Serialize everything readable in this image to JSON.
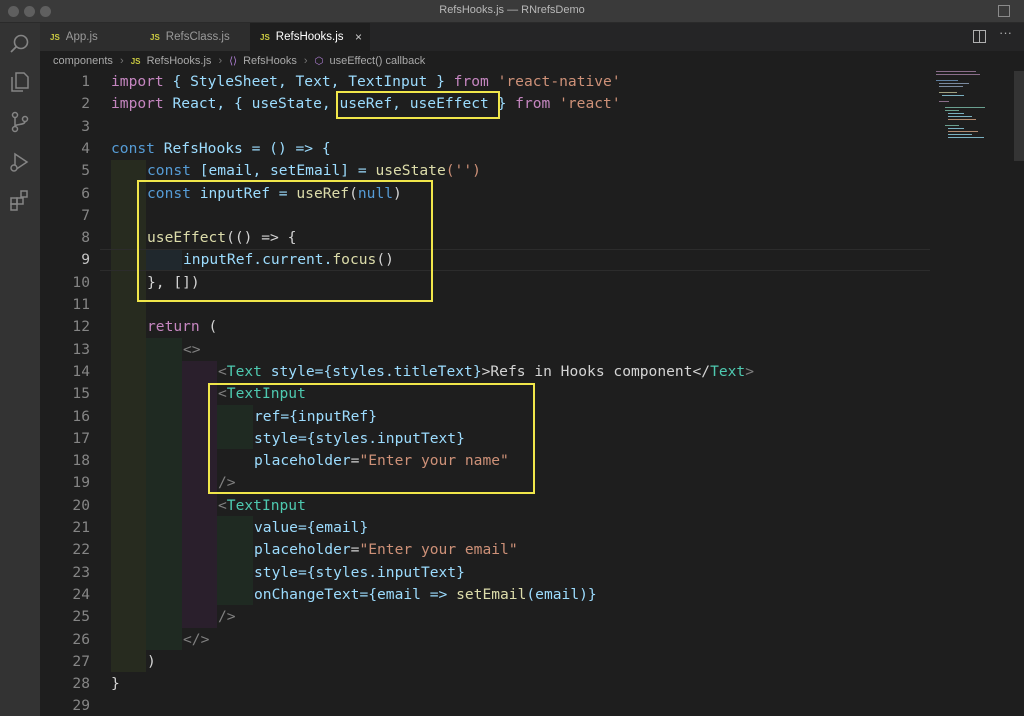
{
  "window": {
    "title": "RefsHooks.js — RNrefsDemo"
  },
  "tabs": [
    {
      "label": "App.js",
      "badge": "JS",
      "active": false
    },
    {
      "label": "RefsClass.js",
      "badge": "JS",
      "active": false
    },
    {
      "label": "RefsHooks.js",
      "badge": "JS",
      "active": true,
      "close": "×"
    }
  ],
  "breadcrumb": {
    "items": [
      "components",
      "RefsHooks.js",
      "RefsHooks",
      "useEffect() callback"
    ],
    "file_badge": "JS",
    "symbol_badge": "⟨⟩"
  },
  "code": {
    "current_line": 9,
    "line_numbers": [
      "1",
      "2",
      "3",
      "4",
      "5",
      "6",
      "7",
      "8",
      "9",
      "10",
      "11",
      "12",
      "13",
      "14",
      "15",
      "16",
      "17",
      "18",
      "19",
      "20",
      "21",
      "22",
      "23",
      "24",
      "25",
      "26",
      "27",
      "28",
      "29"
    ],
    "l1": {
      "a": "import",
      "b": " { StyleSheet, Text, TextInput } ",
      "c": "from",
      "d": " 'react-native'"
    },
    "l2": {
      "a": "import",
      "b": " React, { useState, useRef, useEffect } ",
      "c": "from",
      "d": " 'react'"
    },
    "l4": {
      "a": "const",
      "b": " RefsHooks = () => {"
    },
    "l5": {
      "a": "const",
      "b": " [email, setEmail] = ",
      "c": "useState",
      "d": "('')"
    },
    "l6": {
      "a": "const",
      "b": " inputRef = ",
      "c": "useRef",
      "d": "(",
      "e": "null",
      "f": ")"
    },
    "l8": {
      "a": "useEffect",
      "b": "(() => {"
    },
    "l9": {
      "a": "inputRef",
      "b": ".current.",
      "c": "focus",
      "d": "()"
    },
    "l10": {
      "a": "}, [])"
    },
    "l12": {
      "a": "return",
      "b": " ("
    },
    "l13": {
      "a": "<>"
    },
    "l14": {
      "a": "<",
      "b": "Text",
      "c": " style",
      "d": "={styles.titleText}",
      "e": ">Refs in Hooks component</",
      "f": "Text",
      "g": ">"
    },
    "l15": {
      "a": "<",
      "b": "TextInput"
    },
    "l16": {
      "a": "ref",
      "b": "={inputRef}"
    },
    "l17": {
      "a": "style",
      "b": "={styles.inputText}"
    },
    "l18": {
      "a": "placeholder",
      "b": "=",
      "c": "\"Enter your name\""
    },
    "l19": {
      "a": "/>"
    },
    "l20": {
      "a": "<",
      "b": "TextInput"
    },
    "l21": {
      "a": "value",
      "b": "={email}"
    },
    "l22": {
      "a": "placeholder",
      "b": "=",
      "c": "\"Enter your email\""
    },
    "l23": {
      "a": "style",
      "b": "={styles.inputText}"
    },
    "l24": {
      "a": "onChangeText",
      "b": "={email => ",
      "c": "setEmail",
      "d": "(email)}"
    },
    "l25": {
      "a": "/>"
    },
    "l26": {
      "a": "</>"
    },
    "l27": {
      "a": ")"
    },
    "l28": {
      "a": "}"
    }
  },
  "colors": {
    "highlight_box": "#f0e64a",
    "keyword": "#c586c0",
    "storage": "#569cd6",
    "string": "#ce9178",
    "function": "#dcdcaa",
    "variable": "#9cdcfe",
    "component": "#4ec9b0"
  }
}
